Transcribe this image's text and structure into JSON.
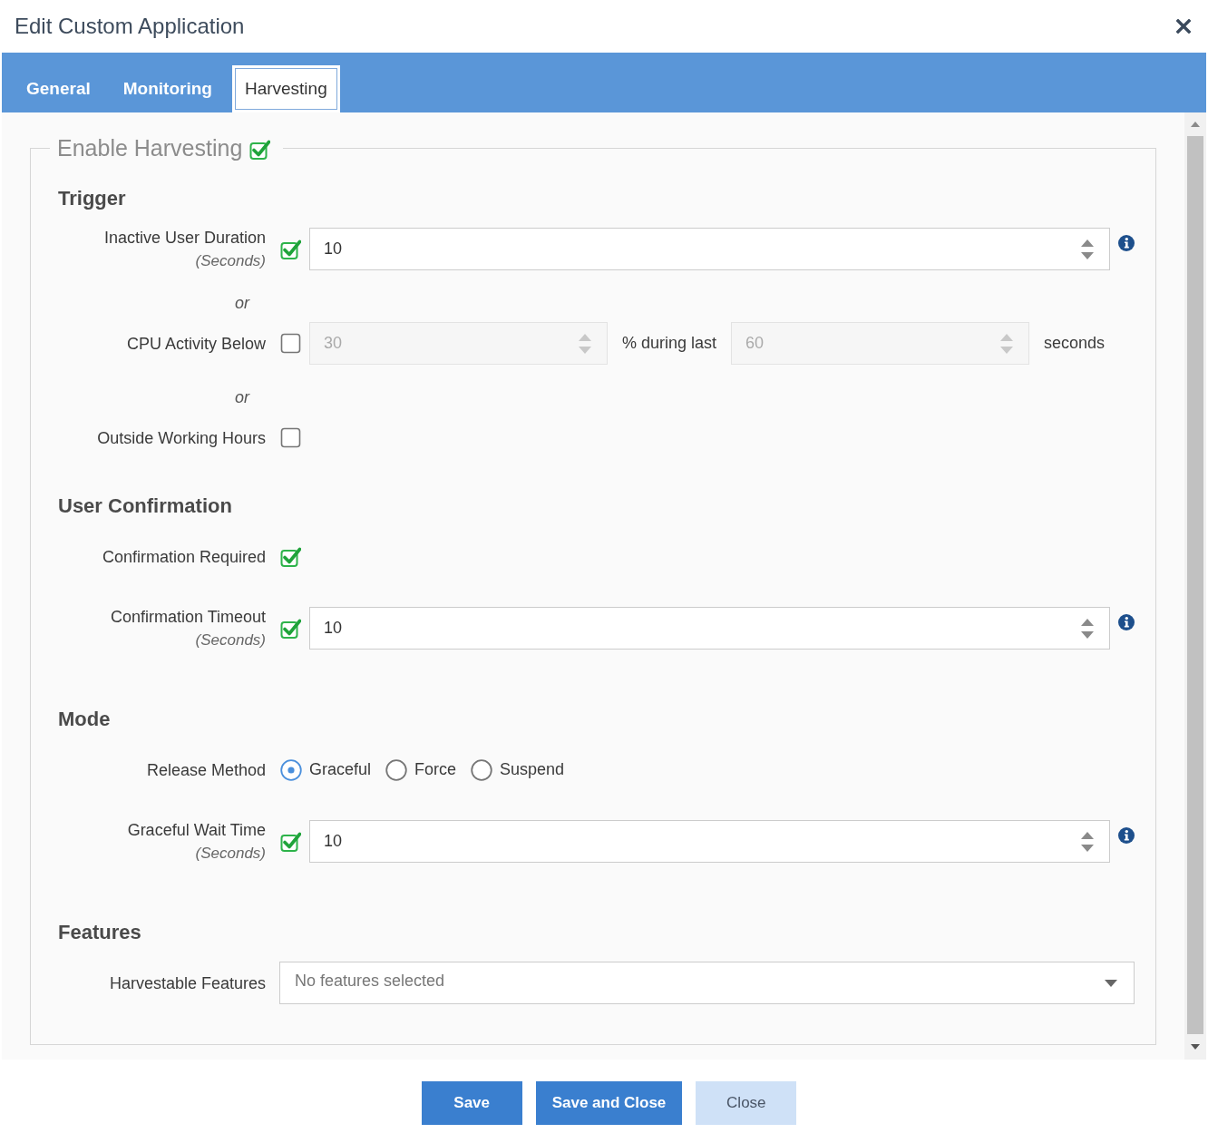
{
  "window": {
    "title": "Edit Custom Application"
  },
  "tabs": [
    {
      "label": "General",
      "selected": false
    },
    {
      "label": "Monitoring",
      "selected": false
    },
    {
      "label": "Harvesting",
      "selected": true
    }
  ],
  "legend": {
    "label": "Enable Harvesting",
    "checked": true
  },
  "sections": [
    {
      "heading": "Trigger",
      "rows": [
        {
          "kind": "number",
          "label": "Inactive User Duration",
          "unit": "(Seconds)",
          "checked": true,
          "value": "10",
          "disabled": false
        },
        {
          "kind": "separator",
          "text": "or"
        },
        {
          "kind": "range",
          "label": "CPU Activity Below",
          "checked": false,
          "value": "30",
          "middle_text": "% during last",
          "value_2": "60",
          "suffix": "seconds",
          "disabled": true
        },
        {
          "kind": "separator",
          "text": "or"
        },
        {
          "kind": "checkbox",
          "label": "Outside Working Hours",
          "checked": false
        }
      ]
    },
    {
      "heading": "User Confirmation",
      "rows": [
        {
          "kind": "checkbox",
          "label": "Confirmation Required",
          "checked": true
        },
        {
          "kind": "number",
          "label": "Confirmation Timeout",
          "unit": "(Seconds)",
          "checked": true,
          "value": "10",
          "disabled": false
        }
      ]
    },
    {
      "heading": "Mode",
      "rows": [
        {
          "kind": "radio",
          "label": "Release Method",
          "options": [
            {
              "label": "Graceful",
              "selected": true
            },
            {
              "label": "Force",
              "selected": false
            },
            {
              "label": "Suspend",
              "selected": false
            }
          ]
        },
        {
          "kind": "number",
          "label": "Graceful Wait Time",
          "unit": "(Seconds)",
          "checked": true,
          "value": "10",
          "disabled": false
        }
      ]
    },
    {
      "heading": "Features",
      "rows": [
        {
          "kind": "select",
          "label": "Harvestable Features",
          "placeholder": "No features selected"
        }
      ]
    }
  ],
  "buttons": [
    {
      "label": "Save",
      "kind": "primary"
    },
    {
      "label": "Save and Close",
      "kind": "primary"
    },
    {
      "label": "Close",
      "kind": "secondary"
    }
  ]
}
